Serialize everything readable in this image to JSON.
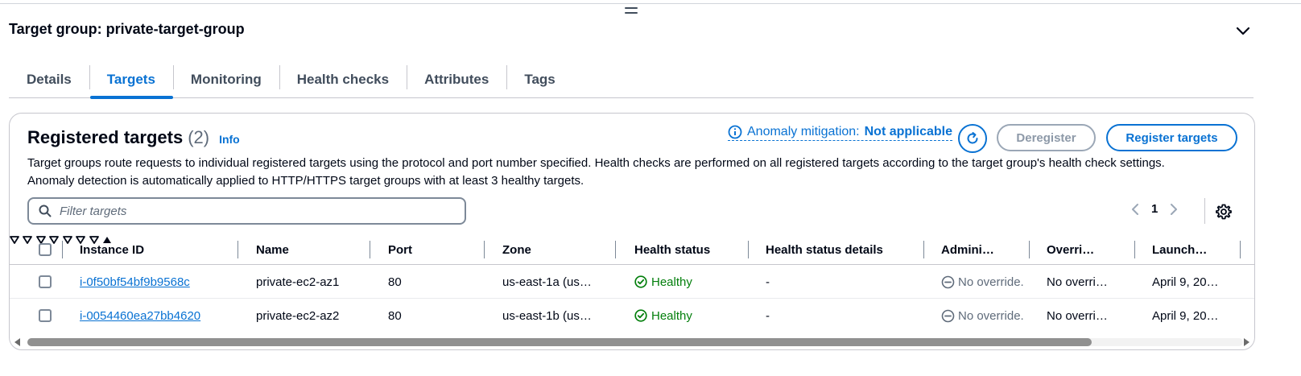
{
  "header": {
    "title": "Target group: private-target-group"
  },
  "tabs": [
    {
      "label": "Details"
    },
    {
      "label": "Targets",
      "active": true
    },
    {
      "label": "Monitoring"
    },
    {
      "label": "Health checks"
    },
    {
      "label": "Attributes"
    },
    {
      "label": "Tags"
    }
  ],
  "panel": {
    "title": "Registered targets",
    "count": "(2)",
    "info_label": "Info",
    "anomaly_label": "Anomaly mitigation:",
    "anomaly_value": "Not applicable",
    "deregister_label": "Deregister",
    "register_label": "Register targets",
    "description_line1": "Target groups route requests to individual registered targets using the protocol and port number specified. Health checks are performed on all registered targets according to the target group's health check settings.",
    "description_line2": "Anomaly detection is automatically applied to HTTP/HTTPS target groups with at least 3 healthy targets.",
    "filter_placeholder": "Filter targets",
    "page_number": "1"
  },
  "table": {
    "columns": [
      "Instance ID",
      "Name",
      "Port",
      "Zone",
      "Health status",
      "Health status details",
      "Admini…",
      "Overri…",
      "Launch…"
    ],
    "rows": [
      {
        "instance_id": "i-0f50bf54bf9b9568c",
        "name": "private-ec2-az1",
        "port": "80",
        "zone": "us-east-1a (us…",
        "health": "Healthy",
        "details": "-",
        "admin": "No override.",
        "override": "No overri…",
        "launch": "April 9, 20…"
      },
      {
        "instance_id": "i-0054460ea27bb4620",
        "name": "private-ec2-az2",
        "port": "80",
        "zone": "us-east-1b (us…",
        "health": "Healthy",
        "details": "-",
        "admin": "No override.",
        "override": "No overri…",
        "launch": "April 9, 20…"
      }
    ]
  },
  "colors": {
    "accent": "#0972d3",
    "healthy": "#037f0c",
    "text": "#000716",
    "muted": "#5f6b7a",
    "border": "#c6c6cd"
  }
}
